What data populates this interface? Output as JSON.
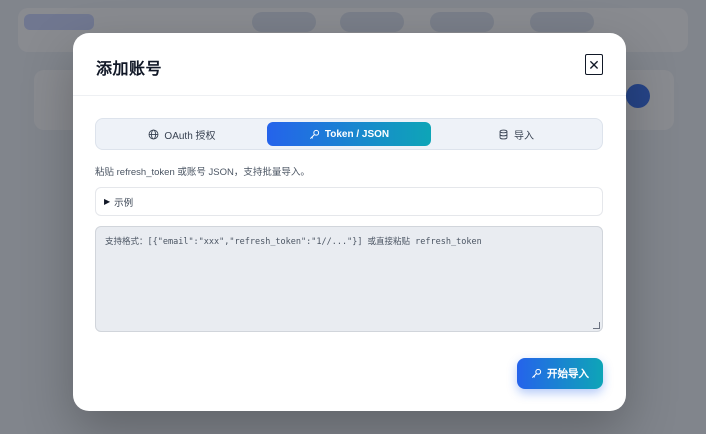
{
  "modal": {
    "title": "添加账号",
    "close_label": "✕"
  },
  "tabs": [
    {
      "label": "OAuth 授权",
      "icon": "globe-icon",
      "active": false
    },
    {
      "label": "Token / JSON",
      "icon": "key-icon",
      "active": true
    },
    {
      "label": "导入",
      "icon": "database-icon",
      "active": false
    }
  ],
  "hint": "粘贴 refresh_token 或账号 JSON，支持批量导入。",
  "example": {
    "marker": "▶",
    "label": "示例"
  },
  "textarea": {
    "placeholder": "支持格式：[{\"email\":\"xxx\",\"refresh_token\":\"1//...\"}] 或直接粘贴 refresh_token",
    "value": ""
  },
  "submit": {
    "label": "开始导入",
    "icon": "key-icon"
  },
  "colors": {
    "accent_start": "#2563eb",
    "accent_end": "#0ea5b7"
  }
}
